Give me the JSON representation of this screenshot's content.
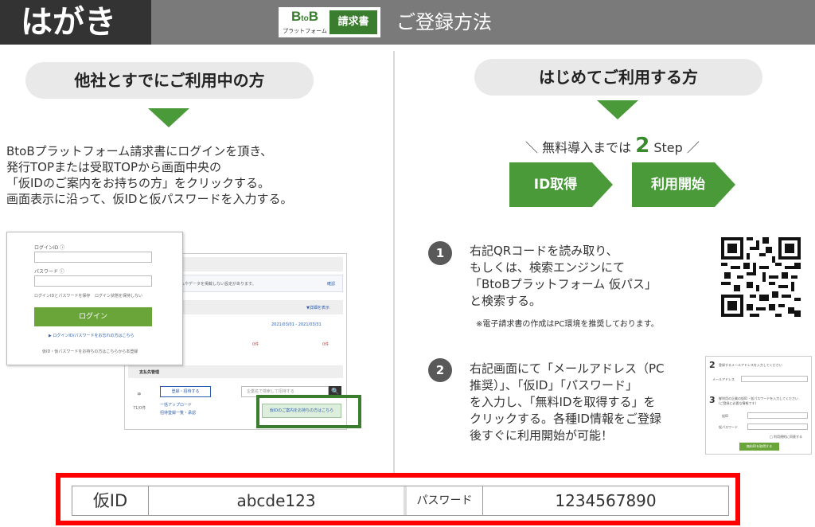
{
  "header": {
    "badge": "はがき",
    "logo_btob_b1": "B",
    "logo_btob_to": "to",
    "logo_btob_b2": "B",
    "logo_sub": "プラットフォーム",
    "logo_right": "請求書",
    "title": "ご登録方法",
    "colors": {
      "header_bg": "#7a7a7a",
      "badge_bg": "#333333",
      "brand_green": "#3a7d2e"
    }
  },
  "left": {
    "pill": "他社とすでにご利用中の方",
    "instructions": [
      "BtoBプラットフォーム請求書にログインを頂き、",
      "発行TOPまたは受取TOPから画面中央の",
      "「仮IDのご案内をお持ちの方」をクリックする。",
      "画面表示に沿って、仮IDと仮パスワードを入力する。"
    ],
    "login_card": {
      "id_label": "ログインID ⓘ",
      "password_label": "パスワード ⓘ",
      "check1": "ログインIDとパスワードを保存",
      "check2": "ログイン状態を保持しない",
      "login_button": "ログイン",
      "forgot_link": "▶ ログインID/パスワードをお忘れの方はこちら",
      "note": "仮ID・仮パスワードをお持ちの方はこちらから本登録"
    },
    "mock_back": {
      "info_text": "ムやデータを掲載しない設定があります。",
      "info_link": "確認",
      "filter_link": "▼詳細を表示",
      "date_range": "2021/03/01 - 2021/03/31",
      "red_a": "0件",
      "red_b": "0件",
      "section_title": "支払先管理",
      "side_label": "71/0件",
      "register_button": "登録・招待する",
      "search_placeholder": "企業名で検索して招待する",
      "search_icon_glyph": "🔍",
      "upload_link": "一括アップロード",
      "list_link": "招待登録一覧・承認",
      "highlight_button": "仮IDのご案内をお持ちの方はこちら"
    }
  },
  "right": {
    "pill": "はじめてご利用する方",
    "step_prefix": "＼ 無料導入までは",
    "step_num": "2",
    "step_suffix": "Step ／",
    "chevrons": [
      "ID取得",
      "利用開始"
    ],
    "step1": {
      "num": "1",
      "lines": [
        "右記QRコードを読み取り、",
        "もしくは、検索エンジンにて",
        "「BtoBプラットフォーム 仮パス」",
        "と検索する。"
      ],
      "note": "※電子請求書の作成はPC環境を推奨しております。"
    },
    "step2": {
      "num": "2",
      "lines": [
        "右記画面にて「メールアドレス（PC",
        "推奨）」、「仮ID」「パスワード」",
        "を入力し、「無料IDを取得する」を",
        "クリックする。各種ID情報をご登録",
        "後すぐに利用開始が可能！"
      ]
    },
    "reg_card": {
      "n2": "2",
      "t2": "登録するメールアドレスを入力してください",
      "mail_label": "メールアドレス",
      "n3": "3",
      "t3a": "御利用の企業の仮ID・仮パスワードを入力してください",
      "t3b": "(ご登録に必要な情報です)",
      "id_label": "仮ID",
      "pw_label": "仮パスワード",
      "agree": "□ 利用規約に同意する",
      "button": "無料IDを取得する"
    }
  },
  "credentials": {
    "id_label": "仮ID",
    "id_value": "abcde123",
    "password_label": "パスワード",
    "password_value": "1234567890",
    "highlight_color": "#ff0000"
  }
}
